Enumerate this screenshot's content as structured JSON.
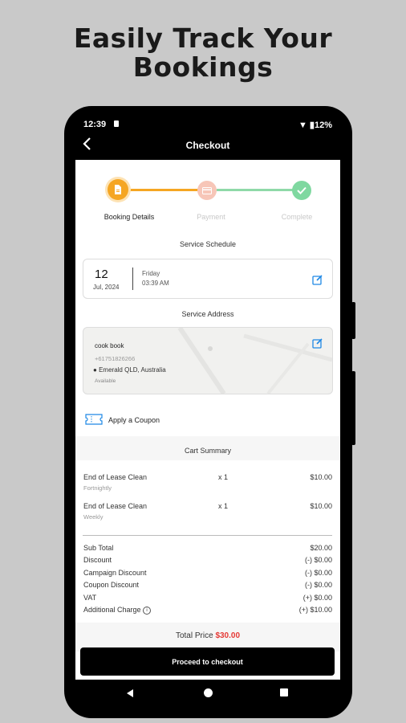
{
  "headline": {
    "line1": "Easily Track Your",
    "line2": "Bookings"
  },
  "status": {
    "time": "12:39",
    "battery": "12%"
  },
  "appbar": {
    "title": "Checkout",
    "back_icon": "chevron-left-icon"
  },
  "stepper": {
    "steps": [
      {
        "label": "Booking Details",
        "state": "active"
      },
      {
        "label": "Payment",
        "state": "pending"
      },
      {
        "label": "Complete",
        "state": "pending"
      }
    ],
    "colors": {
      "active": "#f5a623",
      "pending": "#f7c6b8",
      "complete": "#7fd8a0",
      "line_active": "#f5a623",
      "line_done": "#8fd9a8"
    }
  },
  "schedule": {
    "title": "Service Schedule",
    "day": "12",
    "month_year": "Jul, 2024",
    "weekday": "Friday",
    "time": "03:39 AM"
  },
  "address": {
    "title": "Service Address",
    "name": "cook book",
    "phone": "+61751826266",
    "location": "Emerald QLD, Australia",
    "note": "Available"
  },
  "coupon": {
    "label": "Apply a Coupon"
  },
  "cart": {
    "title": "Cart Summary",
    "items": [
      {
        "name": "End of Lease Clean",
        "frequency": "Fortnightly",
        "qty": "x 1",
        "price": "$10.00"
      },
      {
        "name": "End of Lease Clean",
        "frequency": "Weekly",
        "qty": "x 1",
        "price": "$10.00"
      }
    ],
    "summary": [
      {
        "label": "Sub Total",
        "value": "$20.00"
      },
      {
        "label": "Discount",
        "value": "(-) $0.00"
      },
      {
        "label": "Campaign Discount",
        "value": "(-) $0.00"
      },
      {
        "label": "Coupon Discount",
        "value": "(-) $0.00"
      },
      {
        "label": "VAT",
        "value": "(+) $0.00"
      },
      {
        "label": "Additional Charge",
        "value": "(+) $10.00"
      }
    ]
  },
  "total": {
    "label": "Total Price",
    "value": "$30.00",
    "value_color": "#e53935"
  },
  "checkout_button": {
    "label": "Proceed to checkout"
  }
}
